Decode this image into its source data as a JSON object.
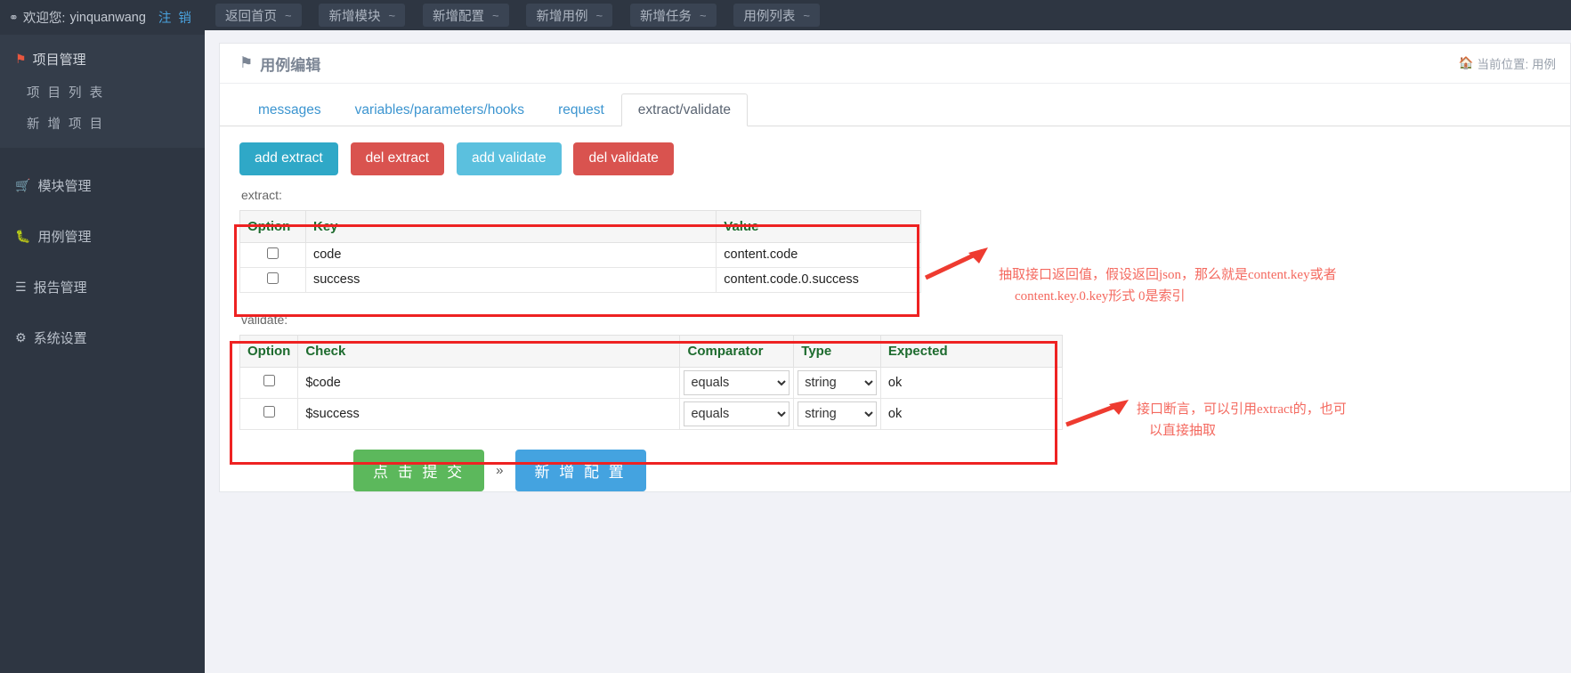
{
  "sidebar": {
    "welcome_prefix": "欢迎您:",
    "username": "yinquanwang",
    "logout": "注 销",
    "group": {
      "title": "项目管理",
      "items": [
        {
          "label": "项 目 列 表"
        },
        {
          "label": "新 增 项 目"
        }
      ]
    },
    "items": [
      {
        "label": "模块管理",
        "icon": "cart-icon"
      },
      {
        "label": "用例管理",
        "icon": "bug-icon"
      },
      {
        "label": "报告管理",
        "icon": "list-icon"
      },
      {
        "label": "系统设置",
        "icon": "gear-icon"
      }
    ]
  },
  "topbar": {
    "tabs": [
      {
        "label": "返回首页",
        "suffix": "~"
      },
      {
        "label": "新增模块",
        "suffix": "~"
      },
      {
        "label": "新增配置",
        "suffix": "~"
      },
      {
        "label": "新增用例",
        "suffix": "~"
      },
      {
        "label": "新增任务",
        "suffix": "~"
      },
      {
        "label": "用例列表",
        "suffix": "~"
      }
    ]
  },
  "card": {
    "title": "用例编辑",
    "breadcrumb": "当前位置: 用例"
  },
  "tabs": [
    {
      "label": "messages",
      "active": false
    },
    {
      "label": "variables/parameters/hooks",
      "active": false
    },
    {
      "label": "request",
      "active": false
    },
    {
      "label": "extract/validate",
      "active": true
    }
  ],
  "buttons": {
    "add_extract": "add extract",
    "del_extract": "del extract",
    "add_validate": "add validate",
    "del_validate": "del validate"
  },
  "extract": {
    "label": "extract:",
    "columns": [
      "Option",
      "Key",
      "Value"
    ],
    "rows": [
      {
        "checked": false,
        "key": "code",
        "value": "content.code"
      },
      {
        "checked": false,
        "key": "success",
        "value": "content.code.0.success"
      }
    ]
  },
  "validate": {
    "label": "validate:",
    "columns": [
      "Option",
      "Check",
      "Comparator",
      "Type",
      "Expected"
    ],
    "comparator_options": [
      "equals"
    ],
    "type_options": [
      "string"
    ],
    "rows": [
      {
        "checked": false,
        "check": "$code",
        "comparator": "equals",
        "type": "string",
        "expected": "ok"
      },
      {
        "checked": false,
        "check": "$success",
        "comparator": "equals",
        "type": "string",
        "expected": "ok"
      }
    ]
  },
  "annotations": {
    "extract_note_line1": "抽取接口返回值，假设返回json，那么就是content.key或者",
    "extract_note_line2": "content.key.0.key形式 0是索引",
    "validate_note_line1": "接口断言，可以引用extract的，也可",
    "validate_note_line2": "以直接抽取",
    "color": "#f4695f"
  },
  "footer": {
    "submit": "点 击 提 交",
    "separator": "»",
    "new_config": "新 增 配 置"
  },
  "colors": {
    "sidebar_bg": "#2e3642",
    "accent_blue": "#3c95d0",
    "header_green": "#1d6b2e",
    "danger": "#d9534f",
    "success": "#5cb85c"
  }
}
